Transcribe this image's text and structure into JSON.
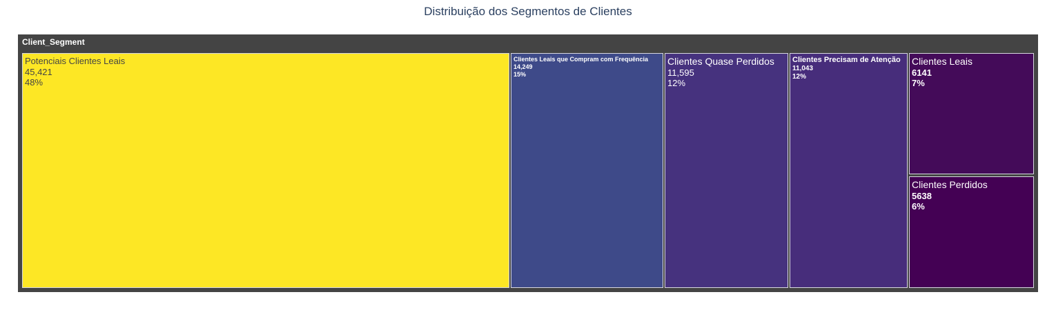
{
  "chart_data": {
    "type": "treemap",
    "title": "Distribuição dos Segmentos de Clientes",
    "root": "Client_Segment",
    "colorscale": "viridis",
    "segments": [
      {
        "name": "Potenciais Clientes Leais",
        "value_label": "45,421",
        "value": 45421,
        "percent_label": "48%",
        "color": "#fde725"
      },
      {
        "name": "Clientes Leais que Compram com Frequência",
        "value_label": "14,249",
        "value": 14249,
        "percent_label": "15%",
        "color": "#3e4a89"
      },
      {
        "name": "Clientes Quase Perdidos",
        "value_label": "11,595",
        "value": 11595,
        "percent_label": "12%",
        "color": "#46327e"
      },
      {
        "name": "Clientes Precisam de Atenção",
        "value_label": "11,043",
        "value": 11043,
        "percent_label": "12%",
        "color": "#472d7b"
      },
      {
        "name": "Clientes Leais",
        "value_label": "6141",
        "value": 6141,
        "percent_label": "7%",
        "color": "#440b59"
      },
      {
        "name": "Clientes Perdidos",
        "value_label": "5638",
        "value": 5638,
        "percent_label": "6%",
        "color": "#440154"
      }
    ]
  }
}
